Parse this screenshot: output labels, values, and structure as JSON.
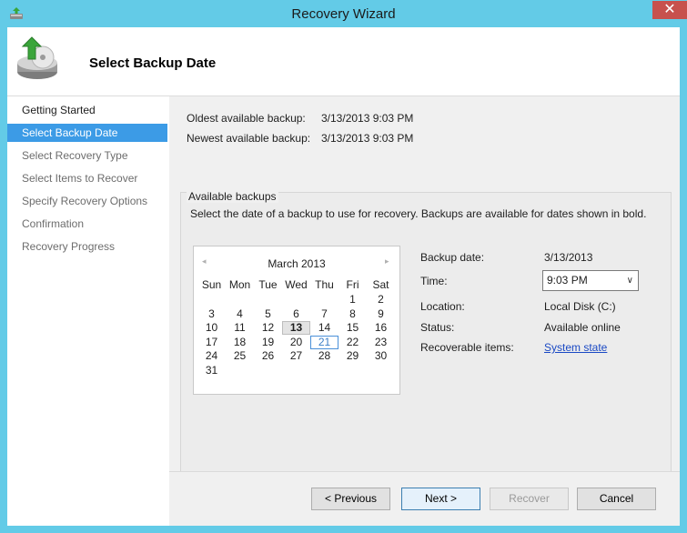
{
  "window": {
    "title": "Recovery Wizard",
    "close_glyph": "✕"
  },
  "header": {
    "title": "Select Backup Date"
  },
  "nav": {
    "items": [
      {
        "label": "Getting Started",
        "state": "done"
      },
      {
        "label": "Select Backup Date",
        "state": "active"
      },
      {
        "label": "Select Recovery Type",
        "state": "pending"
      },
      {
        "label": "Select Items to Recover",
        "state": "pending"
      },
      {
        "label": "Specify Recovery Options",
        "state": "pending"
      },
      {
        "label": "Confirmation",
        "state": "pending"
      },
      {
        "label": "Recovery Progress",
        "state": "pending"
      }
    ]
  },
  "summary": {
    "oldest_label": "Oldest available backup:",
    "oldest_value": "3/13/2013 9:03 PM",
    "newest_label": "Newest available backup:",
    "newest_value": "3/13/2013 9:03 PM"
  },
  "available": {
    "title": "Available backups",
    "description": "Select the date of a backup to use for recovery. Backups are available for dates shown in bold."
  },
  "calendar": {
    "prev_glyph": "◂",
    "next_glyph": "▸",
    "month": "March 2013",
    "weekdays": [
      "Sun",
      "Mon",
      "Tue",
      "Wed",
      "Thu",
      "Fri",
      "Sat"
    ],
    "weeks": [
      [
        "",
        "",
        "",
        "",
        "",
        "1",
        "2"
      ],
      [
        "3",
        "4",
        "5",
        "6",
        "7",
        "8",
        "9"
      ],
      [
        "10",
        "11",
        "12",
        "13",
        "14",
        "15",
        "16"
      ],
      [
        "17",
        "18",
        "19",
        "20",
        "21",
        "22",
        "23"
      ],
      [
        "24",
        "25",
        "26",
        "27",
        "28",
        "29",
        "30"
      ],
      [
        "31",
        "",
        "",
        "",
        "",
        "",
        ""
      ]
    ],
    "backup_day": "13",
    "today": "21"
  },
  "details": {
    "backup_date_label": "Backup date:",
    "backup_date_value": "3/13/2013",
    "time_label": "Time:",
    "time_value": "9:03 PM",
    "location_label": "Location:",
    "location_value": "Local Disk (C:)",
    "status_label": "Status:",
    "status_value": "Available online",
    "recoverable_label": "Recoverable items:",
    "recoverable_value": "System state"
  },
  "buttons": {
    "previous": "< Previous",
    "next": "Next >",
    "recover": "Recover",
    "cancel": "Cancel"
  },
  "colors": {
    "titlebar": "#63cbe7",
    "nav_active": "#3c9be6",
    "link": "#1a49c4",
    "close": "#c7514d"
  }
}
